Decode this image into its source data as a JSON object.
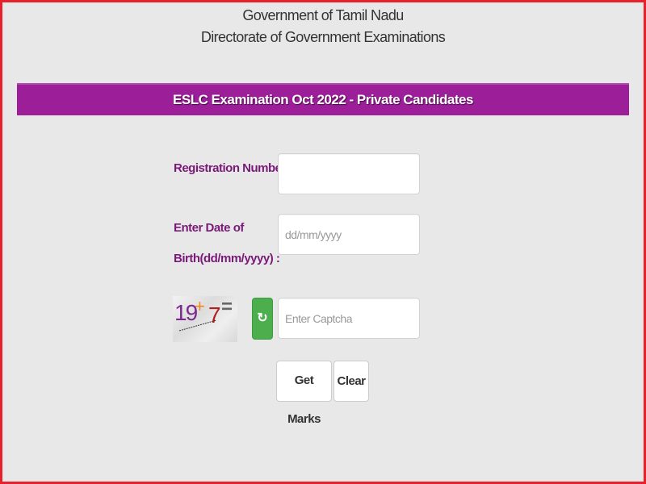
{
  "header": {
    "line1": "Government of Tamil Nadu",
    "line2": "Directorate of Government Examinations"
  },
  "banner": {
    "title": "ESLC Examination Oct 2022 - Private Candidates",
    "color": "#9c1f99"
  },
  "form": {
    "registration": {
      "label": "Registration Number :",
      "value": "",
      "placeholder": ""
    },
    "dob": {
      "label_line1": "Enter Date of",
      "label_line2": "Birth(dd/mm/yyyy) :",
      "value": "",
      "placeholder": "dd/mm/yyyy"
    },
    "captcha": {
      "image_text": {
        "operand1": "19",
        "operator": "+",
        "operand2": "7",
        "equals": "="
      },
      "refresh_icon": "refresh-icon",
      "value": "",
      "placeholder": "Enter Captcha"
    },
    "buttons": {
      "submit_label": "Get Marks",
      "clear_label": "Clear"
    }
  },
  "colors": {
    "frame_border": "#e8202a",
    "label_text": "#7a1a78",
    "refresh_button": "#4cae4c"
  }
}
